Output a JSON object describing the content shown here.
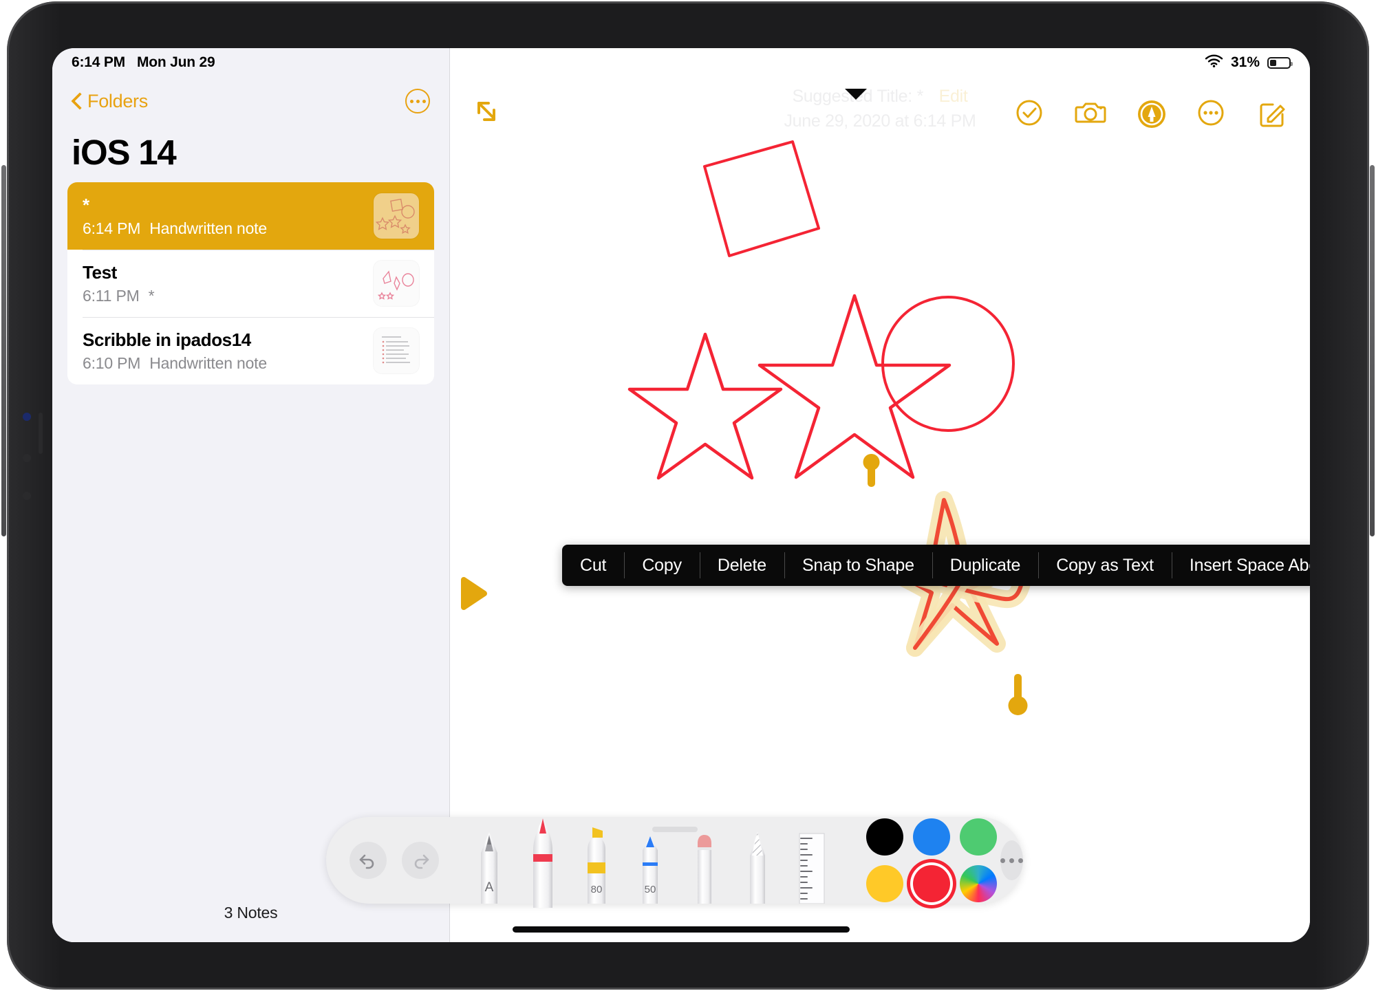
{
  "status_bar": {
    "time": "6:14 PM",
    "date": "Mon Jun 29",
    "battery_percent": "31%",
    "wifi_icon": "wifi-icon",
    "battery_icon": "battery-icon",
    "battery_level": 31
  },
  "sidebar": {
    "back_label": "Folders",
    "back_icon": "chevron-left-icon",
    "more_icon": "ellipsis-circle-icon",
    "folder_title": "iOS 14",
    "notes": [
      {
        "title": "*",
        "time": "6:14 PM",
        "preview": "Handwritten note",
        "selected": true,
        "thumbnail": "shapes-thumbnail"
      },
      {
        "title": "Test",
        "time": "6:11 PM",
        "preview": "*",
        "selected": false,
        "thumbnail": "sketch-thumbnail"
      },
      {
        "title": "Scribble in ipados14",
        "time": "6:10 PM",
        "preview": "Handwritten note",
        "selected": false,
        "thumbnail": "text-thumbnail"
      }
    ],
    "footer_count": "3 Notes"
  },
  "note_detail": {
    "expand_icon": "expand-arrows-icon",
    "suggested_title": "Suggested Title: *",
    "suggested_edit": "Edit",
    "suggested_date": "June 29, 2020 at 6:14 PM",
    "toolbar": [
      {
        "name": "checklist-button",
        "icon": "checkmark-circle-icon",
        "label": "Checklist"
      },
      {
        "name": "camera-button",
        "icon": "camera-icon",
        "label": "Camera"
      },
      {
        "name": "markup-button",
        "icon": "markup-pen-circle-icon",
        "label": "Markup"
      },
      {
        "name": "more-button",
        "icon": "ellipsis-circle-icon",
        "label": "More"
      },
      {
        "name": "compose-button",
        "icon": "compose-icon",
        "label": "New Note"
      }
    ]
  },
  "context_menu": {
    "items": [
      "Cut",
      "Copy",
      "Delete",
      "Snap to Shape",
      "Duplicate",
      "Copy as Text",
      "Insert Space Above"
    ]
  },
  "palette": {
    "undo_icon": "undo-arrow-icon",
    "redo_icon": "redo-arrow-icon",
    "more_icon": "ellipsis-button-icon",
    "tools": [
      {
        "name": "pen-tool",
        "label": "Pen",
        "color": "#9b9b9e",
        "opacity_label": "A"
      },
      {
        "name": "marker-tool",
        "label": "Marker",
        "color": "#e8334a",
        "opacity_label": ""
      },
      {
        "name": "highlighter-tool",
        "label": "Highlighter",
        "color": "#f2c220",
        "opacity_label": "80"
      },
      {
        "name": "fountain-pen-tool",
        "label": "Fountain Pen",
        "color": "#2b7cf6",
        "opacity_label": "50"
      },
      {
        "name": "eraser-tool",
        "label": "Eraser",
        "color": "#e8a0a0",
        "opacity_label": ""
      },
      {
        "name": "lasso-tool",
        "label": "Lasso",
        "color": "#c9c9cc",
        "opacity_label": ""
      },
      {
        "name": "ruler-tool",
        "label": "Ruler",
        "color": "#d2d2d5",
        "opacity_label": ""
      }
    ],
    "colors": [
      {
        "name": "black",
        "hex": "#000000",
        "selected": false
      },
      {
        "name": "blue",
        "hex": "#1e82f0",
        "selected": false
      },
      {
        "name": "green",
        "hex": "#4ecb71",
        "selected": false
      },
      {
        "name": "yellow",
        "hex": "#ffc928",
        "selected": false
      },
      {
        "name": "red",
        "hex": "#f42434",
        "selected": true
      },
      {
        "name": "color-wheel",
        "hex": "rainbow",
        "selected": false
      }
    ]
  },
  "canvas": {
    "drawn_shapes": [
      {
        "name": "square-shape",
        "color": "#f42434"
      },
      {
        "name": "circle-shape",
        "color": "#f42434"
      },
      {
        "name": "star-small-shape",
        "color": "#f42434"
      },
      {
        "name": "star-large-shape",
        "color": "#f42434"
      },
      {
        "name": "selected-star-scribble",
        "color": "#f04a35",
        "selected": true
      }
    ],
    "selection_handles": 2,
    "selection_glow_color": "#f7e6b4",
    "left_marker_icon": "play-triangle-marker"
  },
  "colors": {
    "accent": "#e3a70e",
    "sidebar_bg": "#f2f2f7",
    "selected_note_bg": "#e3a70e",
    "menu_bg": "#0a0a0a",
    "ink_red": "#f42434"
  }
}
